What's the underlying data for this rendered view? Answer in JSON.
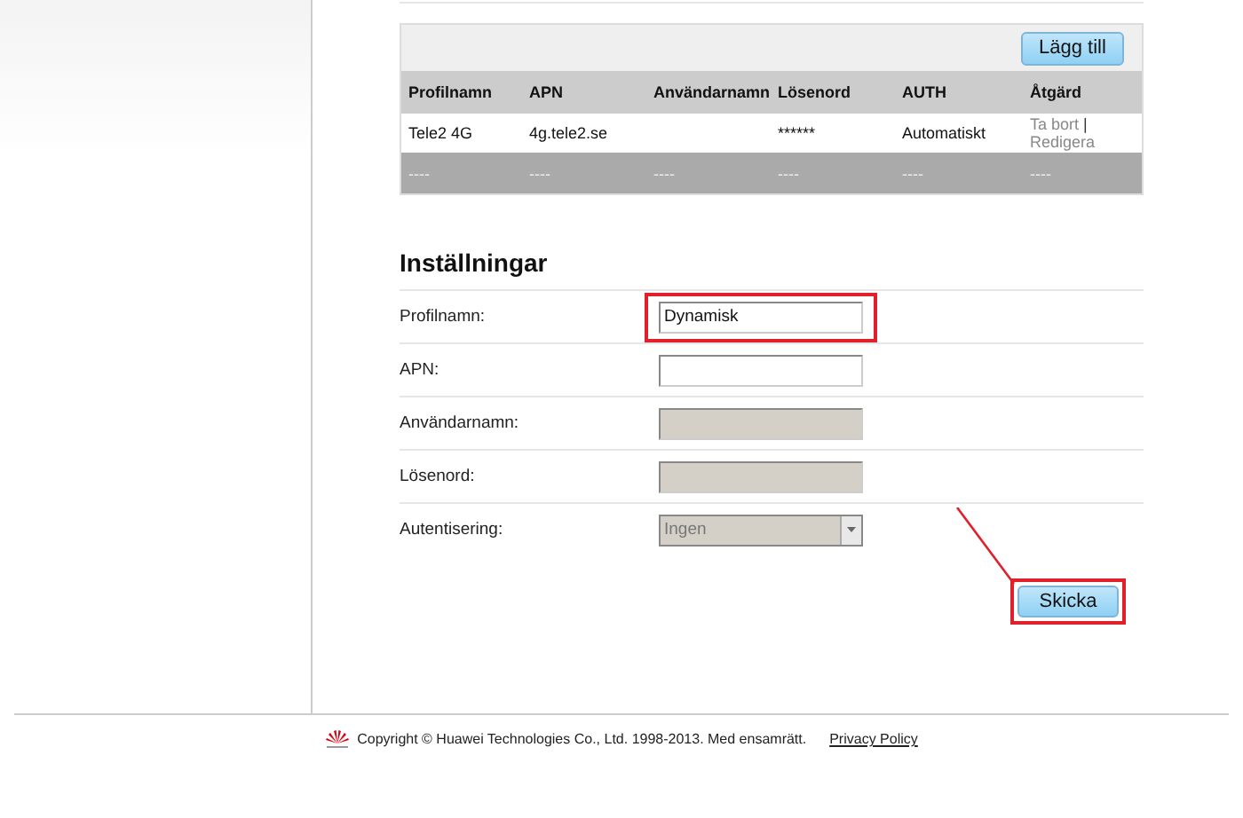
{
  "profiles_table": {
    "add_button": "Lägg till",
    "columns": [
      "Profilnamn",
      "APN",
      "Användarnamn",
      "Lösenord",
      "AUTH",
      "Åtgärd"
    ],
    "rows": [
      {
        "cells": [
          "Tele2 4G",
          "4g.tele2.se",
          null,
          "******",
          "Automatiskt"
        ],
        "actions": [
          "Ta bort",
          "Redigera"
        ],
        "separator": "|"
      }
    ],
    "placeholder_row": [
      "----",
      "----",
      "----",
      "----",
      "----",
      "----"
    ]
  },
  "settings": {
    "title": "Inställningar",
    "fields": [
      {
        "label": "Profilnamn:",
        "kind": "text",
        "value": "Dynamisk",
        "disabled": false,
        "highlighted": true
      },
      {
        "label": "APN:",
        "kind": "text",
        "disabled": false,
        "highlighted": false
      },
      {
        "label": "Användarnamn:",
        "kind": "text",
        "disabled": true,
        "highlighted": false
      },
      {
        "label": "Lösenord:",
        "kind": "text",
        "disabled": true,
        "highlighted": false
      },
      {
        "label": "Autentisering:",
        "kind": "select",
        "value": "Ingen",
        "disabled": true,
        "highlighted": false
      }
    ],
    "submit": {
      "label": "Skicka",
      "highlighted": true
    }
  },
  "footer": {
    "copyright": "Copyright © Huawei Technologies Co., Ltd. 1998-2013. Med ensamrätt.",
    "link": "Privacy Policy"
  }
}
